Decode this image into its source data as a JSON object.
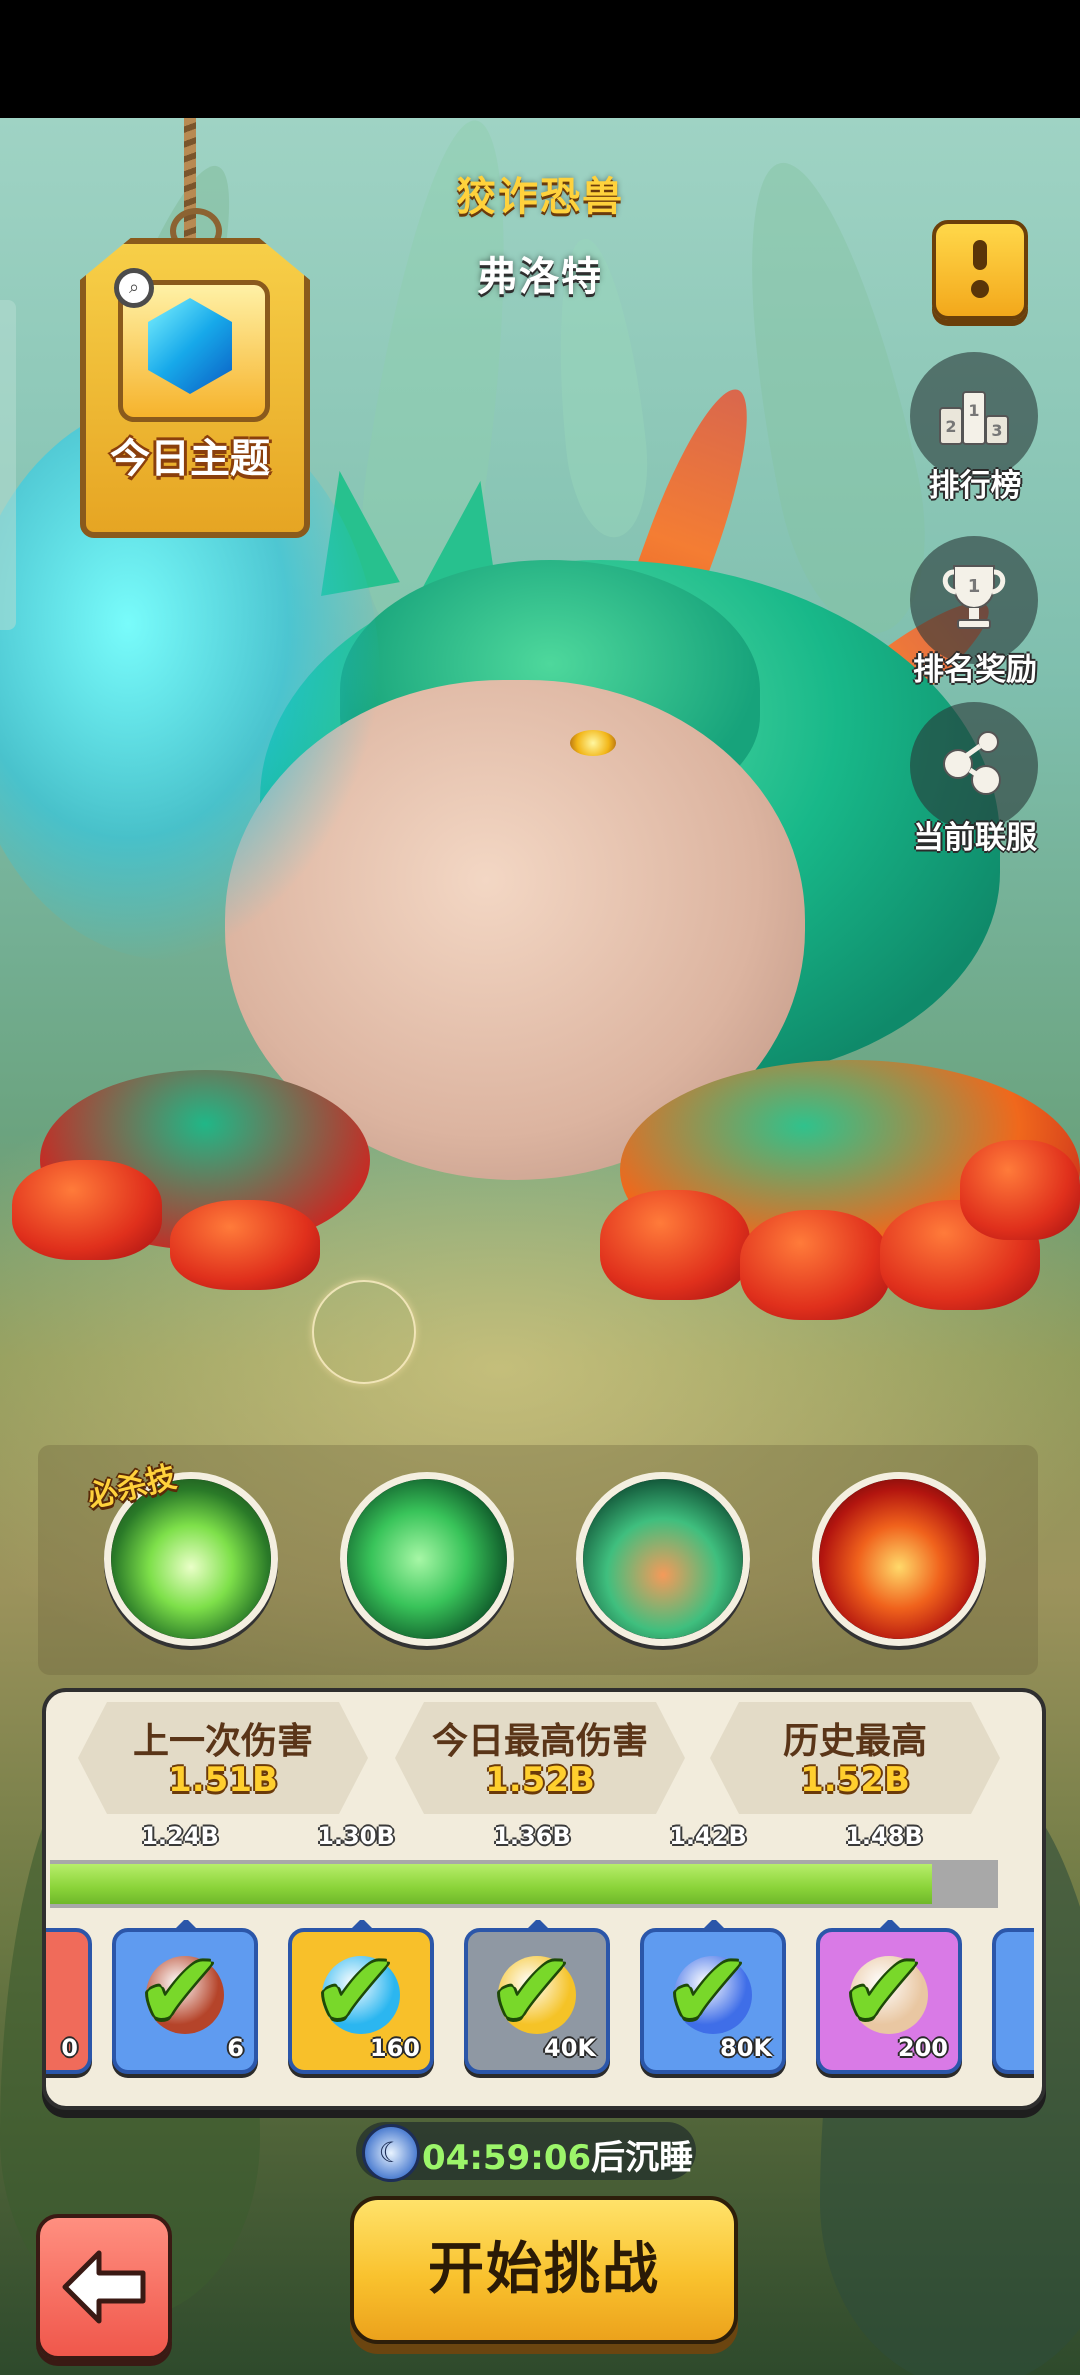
{
  "boss": {
    "type": "狡诈恐兽",
    "name": "弗洛特"
  },
  "theme": {
    "label": "今日主题"
  },
  "side_buttons": {
    "ranking": "排行榜",
    "rank_rewards": "排名奖励",
    "current_server": "当前联服"
  },
  "skills": {
    "ultimate_label": "必杀技",
    "items": [
      "skill-1",
      "skill-2",
      "skill-3",
      "skill-4"
    ]
  },
  "stats": {
    "last_damage": {
      "title": "上一次伤害",
      "value": "1.51B"
    },
    "today_best": {
      "title": "今日最高伤害",
      "value": "1.52B"
    },
    "all_time_best": {
      "title": "历史最高",
      "value": "1.52B"
    }
  },
  "progress": {
    "marks": [
      "1.24B",
      "1.30B",
      "1.36B",
      "1.42B",
      "1.48B"
    ],
    "fill_fraction": 0.93
  },
  "rewards": [
    {
      "qty": "0",
      "color": "#f06b5a",
      "partial": true
    },
    {
      "qty": "6",
      "color": "#5f9bf0",
      "item": "meat-icon"
    },
    {
      "qty": "160",
      "color": "#f8c02a",
      "item": "blue-gem-icon"
    },
    {
      "qty": "40K",
      "color": "#8f98a3",
      "item": "gold-coin-icon"
    },
    {
      "qty": "80K",
      "color": "#5f9bf0",
      "item": "blue-crystal-icon"
    },
    {
      "qty": "200",
      "color": "#d97ae6",
      "item": "scroll-icon"
    },
    {
      "qty": "",
      "color": "#5f9bf0",
      "partial": true
    }
  ],
  "timer": {
    "time": "04:59:06",
    "suffix": "后沉睡"
  },
  "buttons": {
    "start": "开始挑战"
  },
  "colors": {
    "accent_gold": "#ffd23c",
    "progress_green": "#8ad339",
    "panel_bg": "#f2ecdc"
  }
}
